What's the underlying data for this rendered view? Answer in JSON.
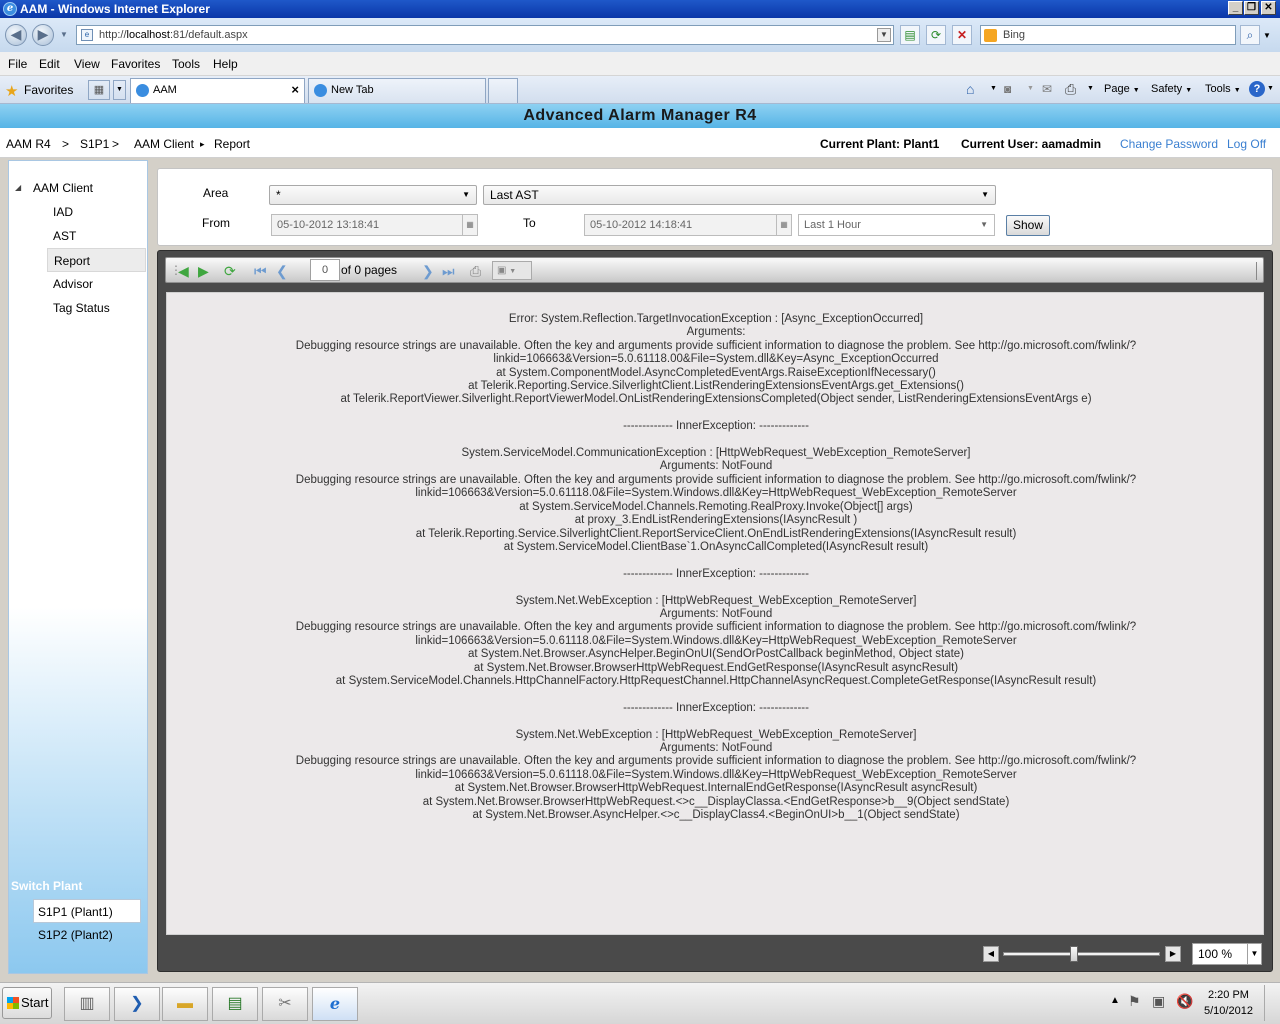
{
  "window": {
    "title": "AAM - Windows Internet Explorer"
  },
  "address": {
    "url_prefix": "http://",
    "host": "localhost",
    "url_rest": ":81/default.aspx",
    "search_placeholder": "Bing"
  },
  "menu": [
    "File",
    "Edit",
    "View",
    "Favorites",
    "Tools",
    "Help"
  ],
  "favorites_label": "Favorites",
  "tabs": [
    {
      "label": "AAM"
    },
    {
      "label": "New Tab"
    }
  ],
  "commands": {
    "page": "Page",
    "safety": "Safety",
    "tools": "Tools"
  },
  "app": {
    "banner": "Advanced Alarm Manager R4"
  },
  "breadcrumb": {
    "root": "AAM R4",
    "sep1": ">",
    "site": "S1P1",
    "sep2": ">",
    "client": "AAM Client",
    "arrow": "▸",
    "page": "Report"
  },
  "user_info": {
    "plant": "Current Plant: Plant1",
    "user": "Current User: aamadmin",
    "change_password": "Change Password",
    "log_off": "Log Off"
  },
  "nav": {
    "root": "AAM Client",
    "items": [
      "IAD",
      "AST",
      "Report",
      "Advisor",
      "Tag Status"
    ],
    "selected": "Report"
  },
  "switch_plant": {
    "title": "Switch Plant",
    "plants": [
      "S1P1 (Plant1)",
      "S1P2 (Plant2)"
    ],
    "selected": "S1P1 (Plant1)"
  },
  "filter": {
    "area_label": "Area",
    "area_value": "*",
    "report_value": "Last AST",
    "from_label": "From",
    "from_value": "05-10-2012 13:18:41",
    "to_label": "To",
    "to_value": "05-10-2012 14:18:41",
    "range_value": "Last 1 Hour",
    "show_label": "Show"
  },
  "viewer": {
    "page_value": "0",
    "of_pages": "of 0 pages",
    "zoom_value": "100 %",
    "zoom_level": 0.45
  },
  "error_lines": [
    "Error: System.Reflection.TargetInvocationException : [Async_ExceptionOccurred]",
    "Arguments:",
    "Debugging resource strings are unavailable. Often the key and arguments provide sufficient information to diagnose the problem. See http://go.microsoft.com/fwlink/?",
    "linkid=106663&Version=5.0.61118.00&File=System.dll&Key=Async_ExceptionOccurred",
    "at System.ComponentModel.AsyncCompletedEventArgs.RaiseExceptionIfNecessary()",
    "at Telerik.Reporting.Service.SilverlightClient.ListRenderingExtensionsEventArgs.get_Extensions()",
    "at Telerik.ReportViewer.Silverlight.ReportViewerModel.OnListRenderingExtensionsCompleted(Object sender, ListRenderingExtensionsEventArgs e)",
    "",
    "------------- InnerException: -------------",
    "",
    "System.ServiceModel.CommunicationException : [HttpWebRequest_WebException_RemoteServer]",
    "Arguments: NotFound",
    "Debugging resource strings are unavailable. Often the key and arguments provide sufficient information to diagnose the problem. See http://go.microsoft.com/fwlink/?",
    "linkid=106663&Version=5.0.61118.0&File=System.Windows.dll&Key=HttpWebRequest_WebException_RemoteServer",
    "at System.ServiceModel.Channels.Remoting.RealProxy.Invoke(Object[] args)",
    "at proxy_3.EndListRenderingExtensions(IAsyncResult )",
    "at Telerik.Reporting.Service.SilverlightClient.ReportServiceClient.OnEndListRenderingExtensions(IAsyncResult result)",
    "at System.ServiceModel.ClientBase`1.OnAsyncCallCompleted(IAsyncResult result)",
    "",
    "------------- InnerException: -------------",
    "",
    "System.Net.WebException : [HttpWebRequest_WebException_RemoteServer]",
    "Arguments: NotFound",
    "Debugging resource strings are unavailable. Often the key and arguments provide sufficient information to diagnose the problem. See http://go.microsoft.com/fwlink/?",
    "linkid=106663&Version=5.0.61118.0&File=System.Windows.dll&Key=HttpWebRequest_WebException_RemoteServer",
    "at System.Net.Browser.AsyncHelper.BeginOnUI(SendOrPostCallback beginMethod, Object state)",
    "at System.Net.Browser.BrowserHttpWebRequest.EndGetResponse(IAsyncResult asyncResult)",
    "at System.ServiceModel.Channels.HttpChannelFactory.HttpRequestChannel.HttpChannelAsyncRequest.CompleteGetResponse(IAsyncResult result)",
    "",
    "------------- InnerException: -------------",
    "",
    "System.Net.WebException : [HttpWebRequest_WebException_RemoteServer]",
    "Arguments: NotFound",
    "Debugging resource strings are unavailable. Often the key and arguments provide sufficient information to diagnose the problem. See http://go.microsoft.com/fwlink/?",
    "linkid=106663&Version=5.0.61118.0&File=System.Windows.dll&Key=HttpWebRequest_WebException_RemoteServer",
    "at System.Net.Browser.BrowserHttpWebRequest.InternalEndGetResponse(IAsyncResult asyncResult)",
    "at System.Net.Browser.BrowserHttpWebRequest.<>c__DisplayClassa.<EndGetResponse>b__9(Object sendState)",
    "at System.Net.Browser.AsyncHelper.<>c__DisplayClass4.<BeginOnUI>b__1(Object sendState)"
  ],
  "taskbar": {
    "start": "Start",
    "time": "2:20 PM",
    "date": "5/10/2012"
  }
}
